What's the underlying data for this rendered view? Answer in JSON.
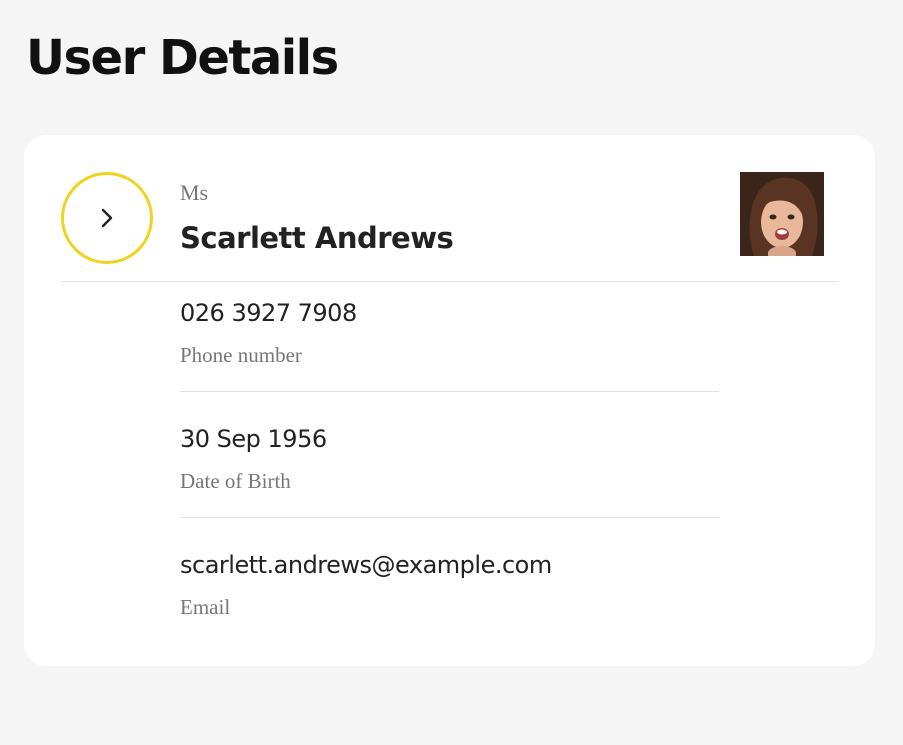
{
  "page": {
    "title": "User Details"
  },
  "user": {
    "salutation": "Ms",
    "name": "Scarlett Andrews",
    "avatar_alt": "Profile photo of Scarlett Andrews"
  },
  "details": [
    {
      "value": "026 3927 7908",
      "label": "Phone number"
    },
    {
      "value": "30 Sep 1956",
      "label": "Date of Birth"
    },
    {
      "value": "scarlett.andrews@example.com",
      "label": "Email"
    }
  ],
  "icons": {
    "expand": "chevron-right-icon"
  },
  "colors": {
    "page_background": "#f5f5f5",
    "card_background": "#ffffff",
    "accent_ring": "#f1d31f",
    "primary_text": "#222222",
    "secondary_text": "#777777",
    "divider": "#e2e2e2"
  }
}
